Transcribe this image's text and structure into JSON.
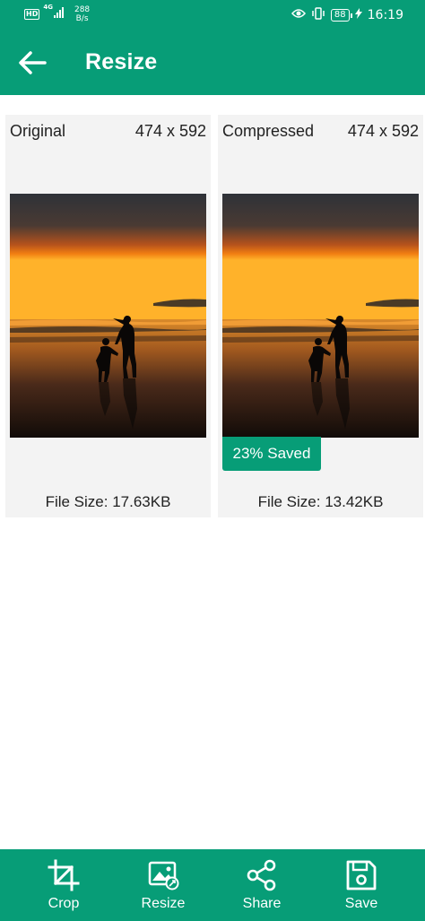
{
  "status_bar": {
    "hd": "HD",
    "network": "4G",
    "speed_value": "288",
    "speed_unit": "B/s",
    "battery": "88",
    "time": "16:19"
  },
  "app_bar": {
    "title": "Resize",
    "back_icon": "arrow-left-icon"
  },
  "original": {
    "label": "Original",
    "dimensions": "474 x 592",
    "file_size": "File Size: 17.63KB"
  },
  "compressed": {
    "label": "Compressed",
    "dimensions": "474 x 592",
    "saved_badge": "23% Saved",
    "file_size": "File Size: 13.42KB"
  },
  "bottom_nav": [
    {
      "label": "Crop",
      "icon": "crop-icon"
    },
    {
      "label": "Resize",
      "icon": "image-resize-icon"
    },
    {
      "label": "Share",
      "icon": "share-icon"
    },
    {
      "label": "Save",
      "icon": "save-icon"
    }
  ],
  "colors": {
    "accent": "#079d77",
    "card_bg": "#f3f3f3",
    "text": "#222222"
  }
}
